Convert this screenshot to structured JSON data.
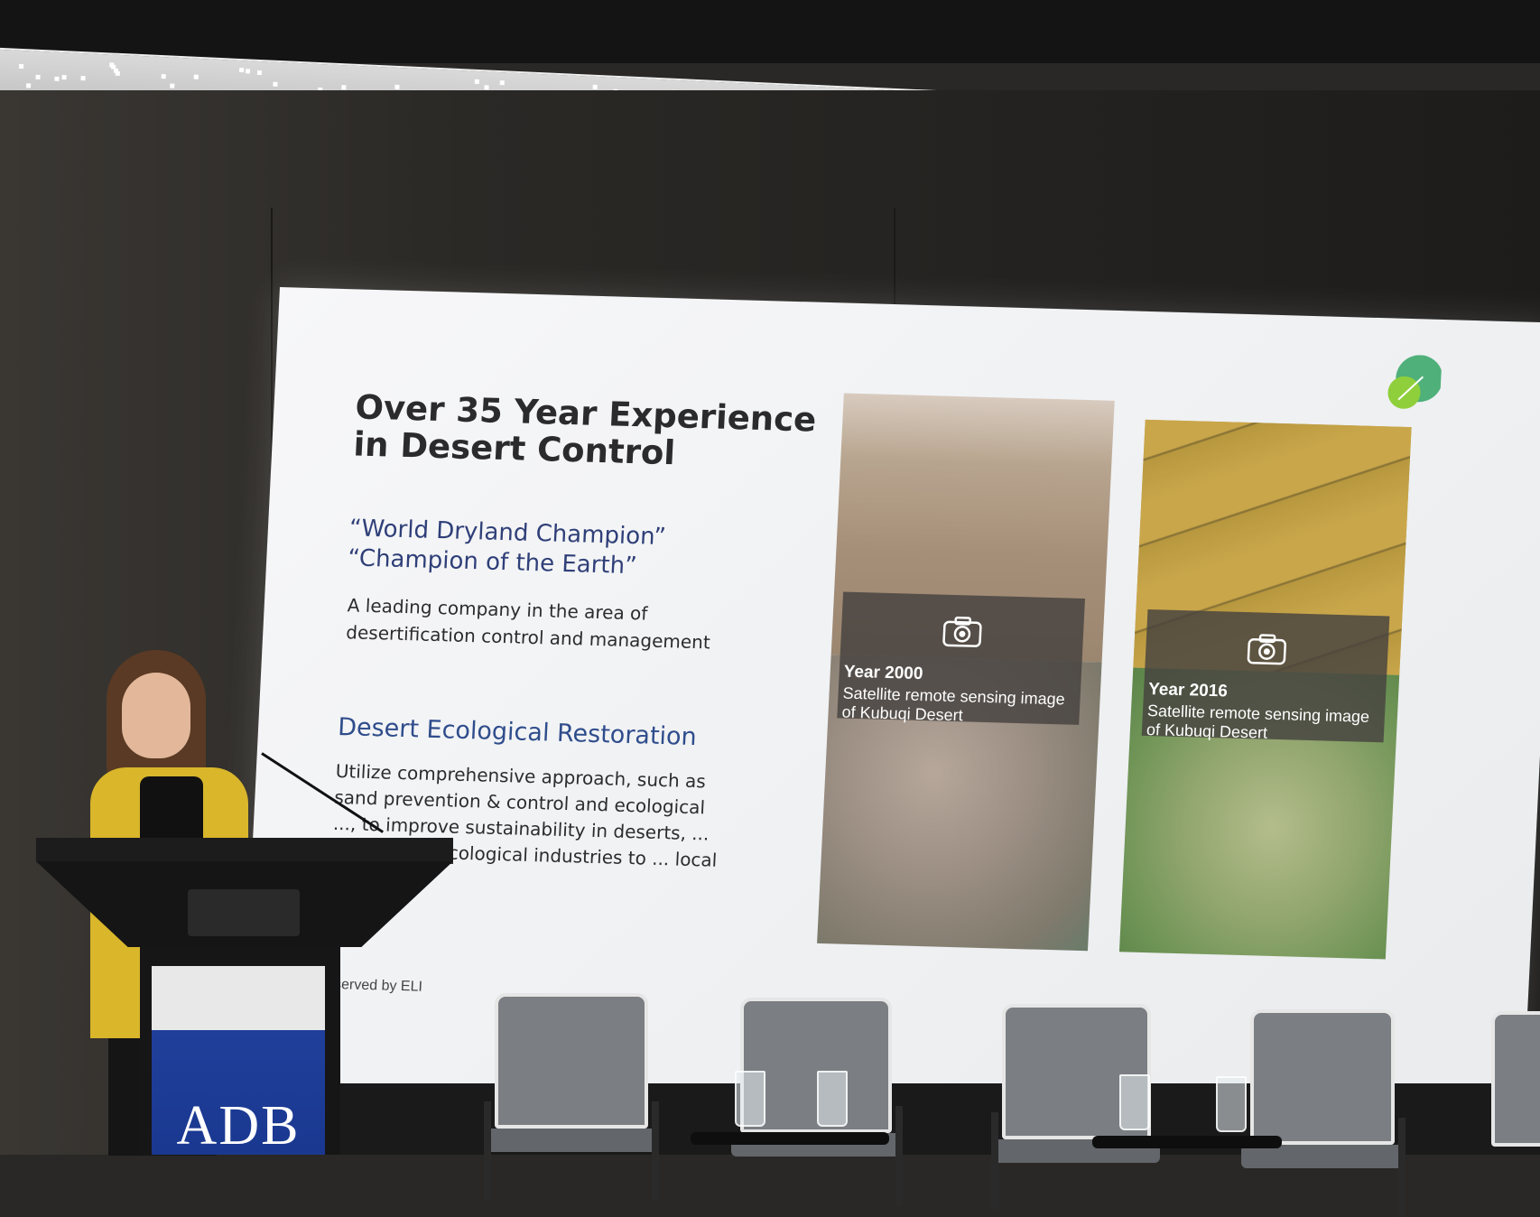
{
  "slide": {
    "title": "Over 35 Year Experience in Desert Control",
    "awards": [
      "“World Dryland Champion”",
      "“Champion of the Earth”"
    ],
    "company_desc": "A leading company in the area of desertification control and management",
    "section_heading": "Desert Ecological Restoration",
    "section_body": "Utilize comprehensive approach, such as sand prevention & control and ecological ..., to improve sustainability in deserts, ... developing ecological industries to ... local economy",
    "footer": "rights reserved by ELI",
    "images": [
      {
        "year": "Year 2000",
        "caption": "Satellite remote sensing image of Kubuqi Desert",
        "icon": "camera-icon"
      },
      {
        "year": "Year 2016",
        "caption": "Satellite remote sensing image of Kubuqi Desert",
        "icon": "camera-icon"
      }
    ]
  },
  "podium": {
    "logo_text": "ADB"
  },
  "colors": {
    "slide_heading": "#2f4d8c",
    "award_text": "#2f3f78",
    "adb_blue": "#1f3f9a",
    "jacket_yellow": "#d9b62a"
  }
}
